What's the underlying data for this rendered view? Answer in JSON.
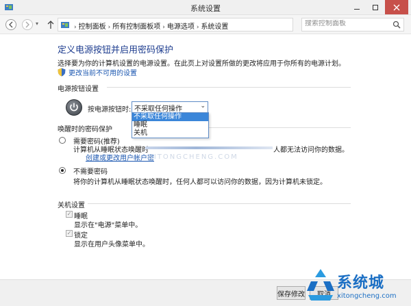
{
  "window": {
    "title": "系统设置"
  },
  "navbar": {
    "breadcrumbs": [
      "控制面板",
      "所有控制面板项",
      "电源选项",
      "系统设置"
    ],
    "search_placeholder": "搜索控制面板"
  },
  "page": {
    "title": "定义电源按钮并启用密码保护",
    "description": "选择要为你的计算机设置的电源设置。在此页上对设置所做的更改将应用于你所有的电源计划。",
    "unavailable_link": "更改当前不可用的设置"
  },
  "power_buttons": {
    "section_label": "电源按钮设置",
    "press_label": "按电源按钮时:",
    "selected": "不采取任何操作",
    "options": [
      "不采取任何操作",
      "睡眠",
      "关机"
    ]
  },
  "password": {
    "section_label": "唤醒时的密码保护",
    "require_label": "需要密码(推荐)",
    "require_desc_start": "计算机从睡眠状态唤醒时",
    "require_desc_end": "人都无法访问你的数据。",
    "create_link": "创建或更改用户帐户密",
    "watermark": "XITONGCHENG.COM",
    "no_password_label": "不需要密码",
    "no_password_desc": "将你的计算机从睡眠状态唤醒时，任何人都可以访问你的数据，因为计算机未锁定。",
    "selected": "no_password"
  },
  "shutdown": {
    "section_label": "关机设置",
    "items": [
      {
        "label": "睡眠",
        "desc": "显示在\"电源\"菜单中。",
        "checked": true
      },
      {
        "label": "锁定",
        "desc": "显示在用户头像菜单中。",
        "checked": true
      }
    ]
  },
  "footer": {
    "save_label": "保存修改",
    "cancel_label": "取消"
  },
  "branding": {
    "logo_text": "系统城",
    "logo_url": "xitongcheng.com"
  },
  "colors": {
    "accent": "#1e3d8f",
    "link": "#1a56b0",
    "close": "#c7504a",
    "selection": "#3b86d9"
  }
}
